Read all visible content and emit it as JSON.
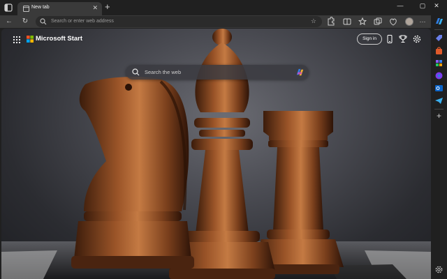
{
  "browser": {
    "tab": {
      "title": "New tab",
      "favicon": "new-tab-icon",
      "close_glyph": "✕"
    },
    "new_tab_glyph": "+",
    "window_controls": {
      "minimize": "—",
      "maximize": "▢",
      "close": "✕"
    },
    "toolbar": {
      "back_glyph": "←",
      "refresh_glyph": "↻",
      "address_placeholder": "Search or enter web address",
      "favorite_glyph": "☆",
      "icons": [
        "extensions-icon",
        "split-screen-icon",
        "favorites-icon",
        "collections-icon",
        "browser-essentials-icon",
        "profile-icon",
        "more-icon"
      ],
      "more_glyph": "···"
    }
  },
  "newtab": {
    "brand": "Microsoft Start",
    "signin_label": "Sign in",
    "search_placeholder": "Search the web",
    "header_icons": [
      "phone-icon",
      "rewards-trophy-icon",
      "settings-gear-icon"
    ],
    "background": "wooden chess pieces (knight, bishop, rook) on a chessboard"
  },
  "sidebar": {
    "items": [
      "copilot-icon",
      "search-tag-icon",
      "shopping-bag-icon",
      "office-icon",
      "games-icon",
      "outlook-icon",
      "telegram-icon",
      "add-icon",
      "sidebar-settings-icon"
    ],
    "add_glyph": "+"
  },
  "colors": {
    "chrome_dark": "#202020",
    "toolbar": "#3a3a3a",
    "accent_copilot": "#2f7de1",
    "wood": "#7a3f1c"
  }
}
